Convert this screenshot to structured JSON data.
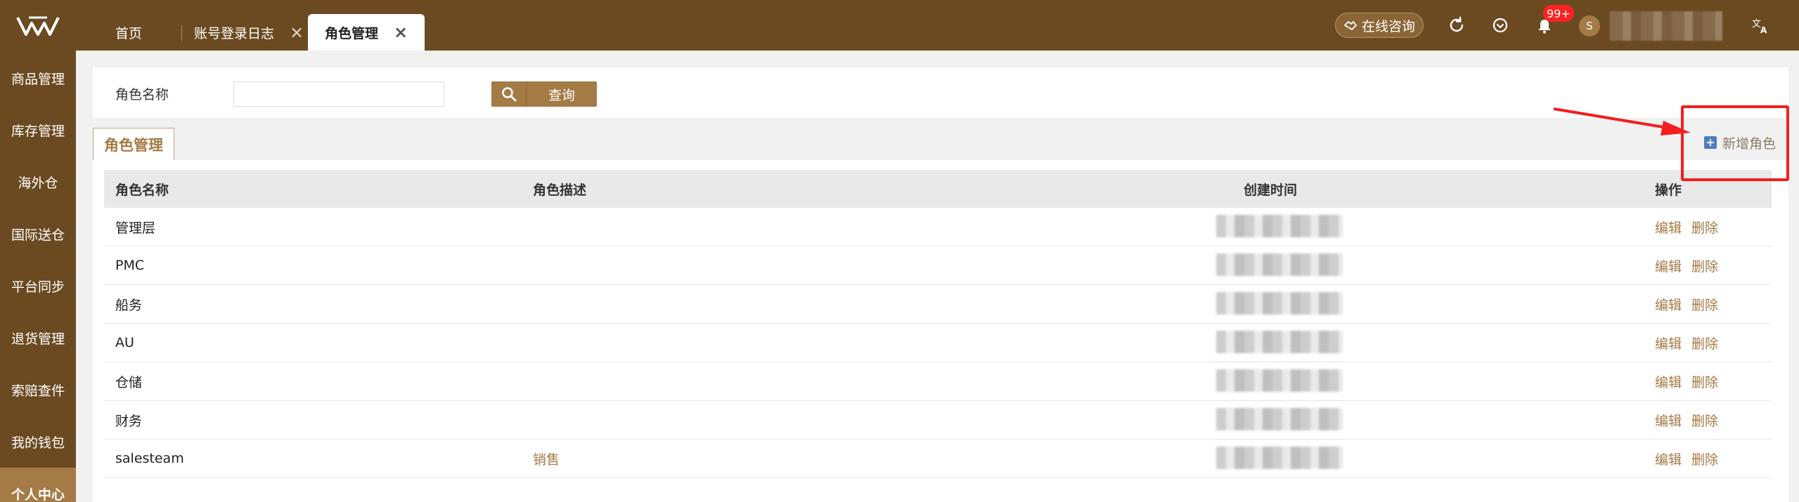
{
  "sidebar": {
    "items": [
      {
        "label": "商品管理"
      },
      {
        "label": "库存管理"
      },
      {
        "label": "海外仓"
      },
      {
        "label": "国际送仓"
      },
      {
        "label": "平台同步"
      },
      {
        "label": "退货管理"
      },
      {
        "label": "索赔查件"
      },
      {
        "label": "我的钱包"
      },
      {
        "label": "个人中心"
      }
    ],
    "active_index": 8
  },
  "tabs": [
    {
      "label": "首页",
      "closable": false
    },
    {
      "label": "账号登录日志",
      "closable": true
    },
    {
      "label": "角色管理",
      "closable": true,
      "active": true
    }
  ],
  "header": {
    "consult_label": "在线咨询",
    "notification_badge": "99+",
    "avatar_initial": "S"
  },
  "search": {
    "label": "角色名称",
    "input_value": "",
    "button_label": "查询"
  },
  "section": {
    "tab_label": "角色管理",
    "add_button_label": "新增角色"
  },
  "table": {
    "headers": [
      "角色名称",
      "角色描述",
      "创建时间",
      "操作"
    ],
    "rows": [
      {
        "name": "管理层",
        "desc": "",
        "time": ""
      },
      {
        "name": "PMC",
        "desc": "",
        "time": ""
      },
      {
        "name": "船务",
        "desc": "",
        "time": ""
      },
      {
        "name": "AU",
        "desc": "",
        "time": ""
      },
      {
        "name": "仓储",
        "desc": "",
        "time": ""
      },
      {
        "name": "财务",
        "desc": "",
        "time": ""
      },
      {
        "name": "salesteam",
        "desc": "销售",
        "time": ""
      }
    ],
    "actions": {
      "edit": "编辑",
      "delete": "删除"
    }
  },
  "colors": {
    "brand_dark": "#6b4a22",
    "brand_accent": "#a47a45",
    "highlight": "#f21f1f"
  }
}
